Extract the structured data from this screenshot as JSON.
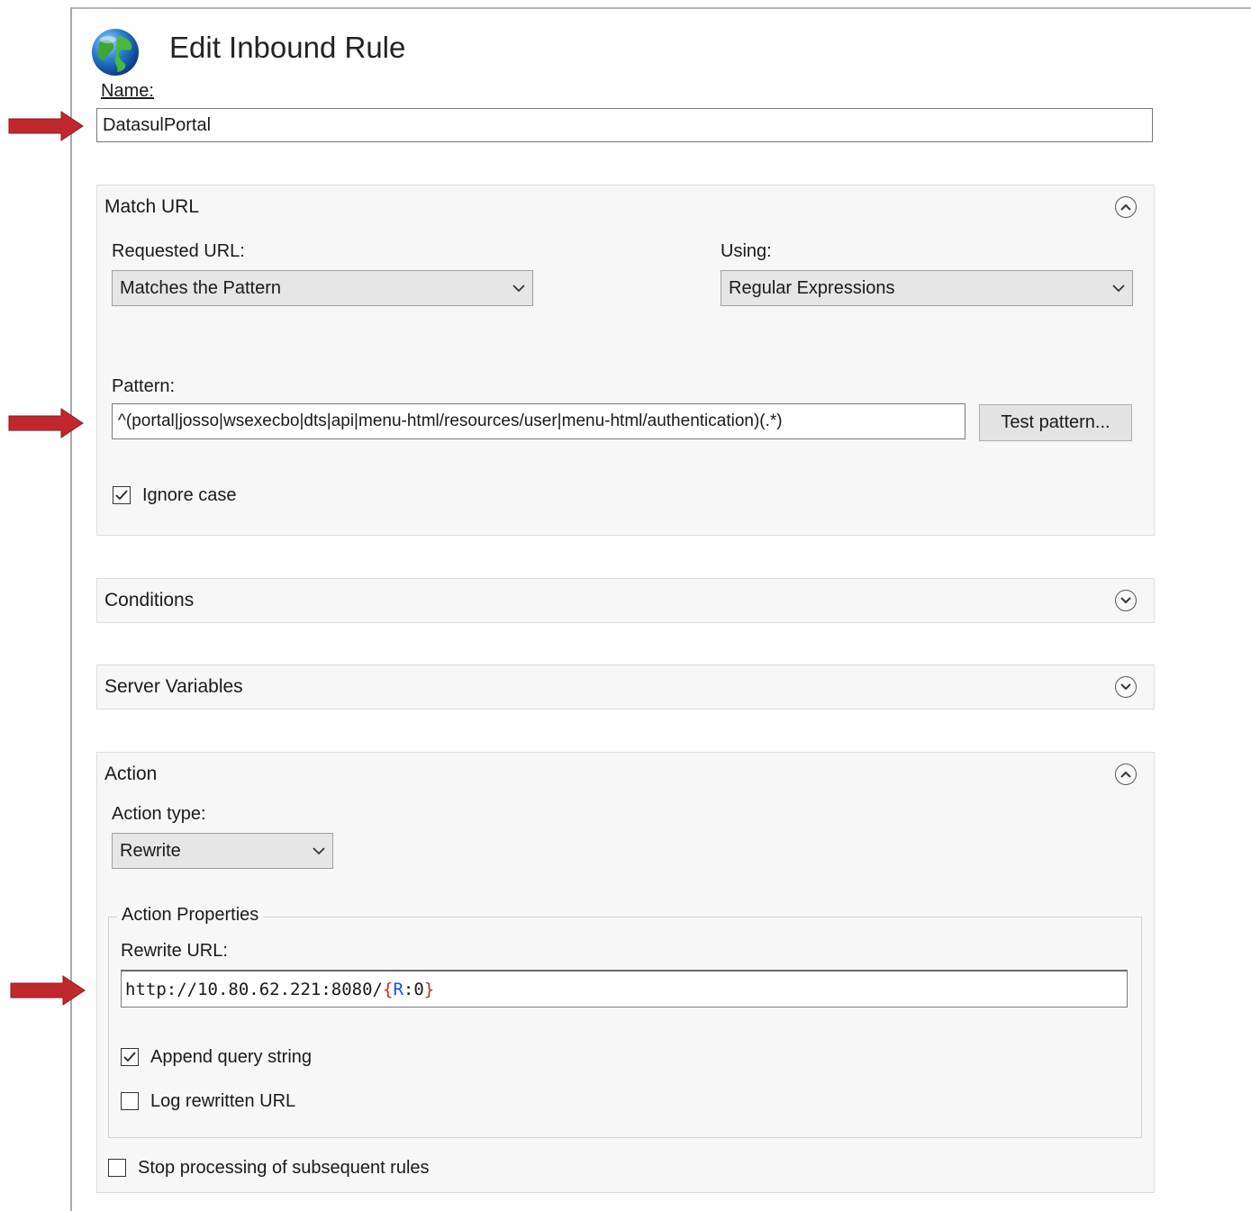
{
  "header": {
    "title": "Edit Inbound Rule",
    "icon": "globe-icon"
  },
  "name_field": {
    "label": "Name:",
    "value": "DatasulPortal"
  },
  "match_url": {
    "title": "Match URL",
    "requested_url": {
      "label": "Requested URL:",
      "value": "Matches the Pattern"
    },
    "using": {
      "label": "Using:",
      "value": "Regular Expressions"
    },
    "pattern": {
      "label": "Pattern:",
      "value": "^(portal|josso|wsexecbo|dts|api|menu-html/resources/user|menu-html/authentication)(.*)"
    },
    "test_button": "Test pattern...",
    "ignore_case": {
      "label": "Ignore case",
      "checked": true
    }
  },
  "conditions": {
    "title": "Conditions"
  },
  "server_variables": {
    "title": "Server Variables"
  },
  "action": {
    "title": "Action",
    "action_type": {
      "label": "Action type:",
      "value": "Rewrite"
    },
    "properties": {
      "legend": "Action Properties",
      "rewrite_url_label": "Rewrite URL:",
      "rewrite_url_prefix": "http://10.80.62.221:8080/",
      "rewrite_url_open": "{",
      "rewrite_url_var": "R",
      "rewrite_url_rest": ":0",
      "rewrite_url_close": "}"
    },
    "append_query": {
      "label": "Append query string",
      "checked": true
    },
    "log_rewritten": {
      "label": "Log rewritten URL",
      "checked": false
    },
    "stop_processing": {
      "label": "Stop processing of subsequent rules",
      "checked": false
    }
  },
  "colors": {
    "annotation_arrow": "#c0282d",
    "var_blue": "#1a4fd6",
    "brace_red": "#c0282d"
  }
}
